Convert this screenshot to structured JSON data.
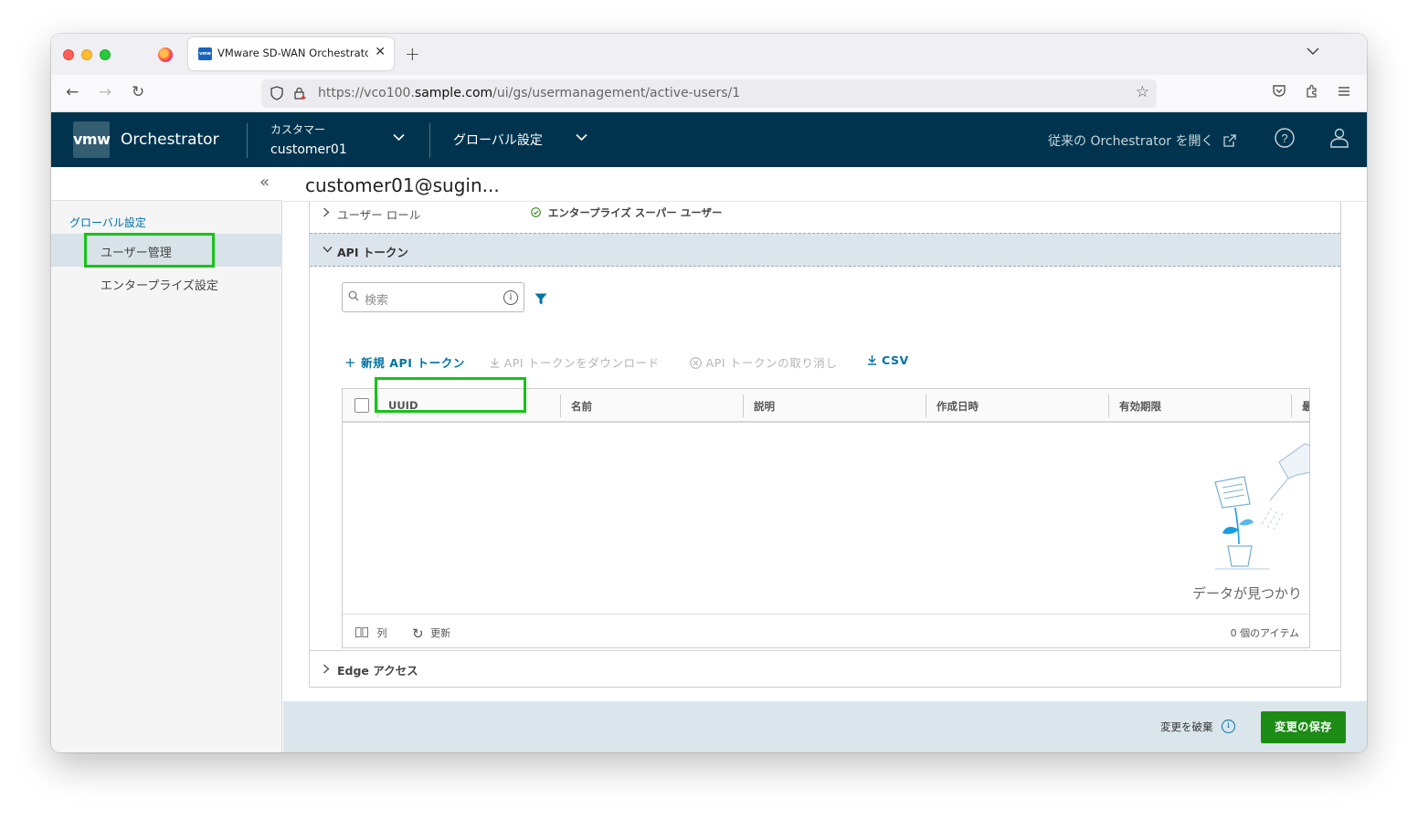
{
  "browser": {
    "tab_title": "VMware SD-WAN Orchestrator",
    "tab_favicon_text": "vmw",
    "url_prefix": "https://vco100.",
    "url_domain": "sample.com",
    "url_path": "/ui/gs/usermanagement/active-users/1"
  },
  "header": {
    "logo_text": "vmw",
    "app_title": "Orchestrator",
    "customer_label": "カスタマー",
    "customer_value": "customer01",
    "global_settings": "グローバル設定",
    "legacy_link": "従来の Orchestrator を開く"
  },
  "sidebar": {
    "section": "グローバル設定",
    "items": [
      {
        "label": "ユーザー管理",
        "active": true
      },
      {
        "label": "エンタープライズ設定",
        "active": false
      }
    ]
  },
  "content": {
    "page_title": "customer01@sugin...",
    "user_role_label": "ユーザー ロール",
    "user_role_value": "エンタープライズ スーパー ユーザー",
    "api_token_label": "API トークン",
    "search_placeholder": "検索",
    "toolbar": {
      "new_token": "新規 API トークン",
      "download_token": "API トークンをダウンロード",
      "revoke_token": "API トークンの取り消し",
      "csv": "CSV"
    },
    "grid": {
      "columns": [
        "UUID",
        "名前",
        "説明",
        "作成日時",
        "有効期限",
        "最"
      ],
      "empty_text": "データが見つかり",
      "footer_columns": "列",
      "footer_refresh": "更新",
      "item_count": "0 個のアイテム"
    },
    "edge_access_label": "Edge アクセス"
  },
  "footer": {
    "discard": "変更を破棄",
    "save": "変更の保存"
  },
  "colors": {
    "header_bg": "#00344e",
    "accent": "#0072a3",
    "save_green": "#1d8c17",
    "highlight": "#17c317"
  }
}
